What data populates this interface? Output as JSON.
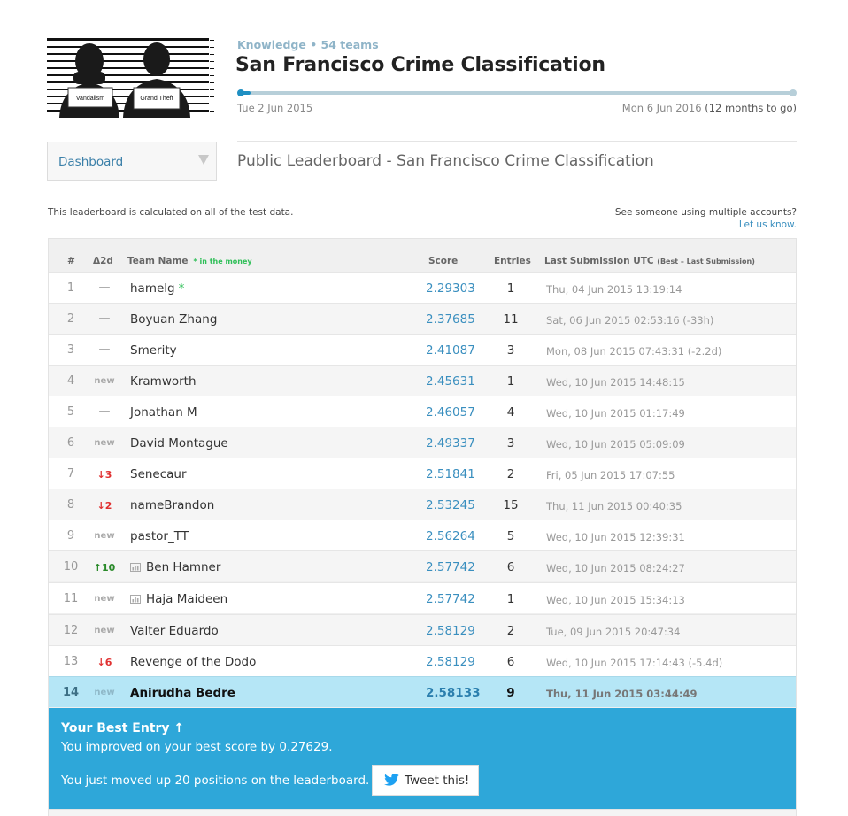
{
  "logo": {
    "label_left": "Vandalism",
    "label_right": "Grand Theft"
  },
  "competition": {
    "meta": "Knowledge • 54 teams",
    "title": "San Francisco Crime Classification",
    "start_date": "Tue 2 Jun 2015",
    "end_date": "Mon 6 Jun 2016",
    "remaining": "(12 months to go)",
    "elapsed_fraction": 0.02,
    "accent_color": "#1f8fc2"
  },
  "nav": {
    "dropdown_label": "Dashboard",
    "page_title": "Public Leaderboard - San Francisco Crime Classification"
  },
  "notes": {
    "left": "This leaderboard is calculated on all of the test data.",
    "right": "See someone using multiple accounts?",
    "right_link": "Let us know."
  },
  "columns": {
    "rank": "#",
    "delta": "Δ2d",
    "team": "Team Name",
    "in_money": "* in the money",
    "score": "Score",
    "help_icon": "?",
    "entries": "Entries",
    "last_submission": "Last Submission UTC",
    "last_submission_sub": "(Best – Last Submission)"
  },
  "rows": [
    {
      "rank": "1",
      "delta": "—",
      "delta_type": "same",
      "team": "hamelg",
      "star": "*",
      "score": "2.29303",
      "entries": "1",
      "date": "Thu, 04 Jun 2015 13:19:14"
    },
    {
      "rank": "2",
      "delta": "—",
      "delta_type": "same",
      "team": "Boyuan Zhang",
      "score": "2.37685",
      "entries": "11",
      "date": "Sat, 06 Jun 2015 02:53:16 (-33h)"
    },
    {
      "rank": "3",
      "delta": "—",
      "delta_type": "same",
      "team": "Smerity",
      "score": "2.41087",
      "entries": "3",
      "date": "Mon, 08 Jun 2015 07:43:31 (-2.2d)"
    },
    {
      "rank": "4",
      "delta": "new",
      "delta_type": "new",
      "team": "Kramworth",
      "score": "2.45631",
      "entries": "1",
      "date": "Wed, 10 Jun 2015 14:48:15"
    },
    {
      "rank": "5",
      "delta": "—",
      "delta_type": "same",
      "team": "Jonathan M",
      "score": "2.46057",
      "entries": "4",
      "date": "Wed, 10 Jun 2015 01:17:49"
    },
    {
      "rank": "6",
      "delta": "new",
      "delta_type": "new",
      "team": "David Montague",
      "score": "2.49337",
      "entries": "3",
      "date": "Wed, 10 Jun 2015 05:09:09"
    },
    {
      "rank": "7",
      "delta": "↓3",
      "delta_type": "down",
      "team": "Senecaur",
      "score": "2.51841",
      "entries": "2",
      "date": "Fri, 05 Jun 2015 17:07:55"
    },
    {
      "rank": "8",
      "delta": "↓2",
      "delta_type": "down",
      "team": "nameBrandon",
      "score": "2.53245",
      "entries": "15",
      "date": "Thu, 11 Jun 2015 00:40:35"
    },
    {
      "rank": "9",
      "delta": "new",
      "delta_type": "new",
      "team": "pastor_TT",
      "score": "2.56264",
      "entries": "5",
      "date": "Wed, 10 Jun 2015 12:39:31"
    },
    {
      "rank": "10",
      "delta": "↑10",
      "delta_type": "up",
      "team": "Ben Hamner",
      "profile": true,
      "score": "2.57742",
      "entries": "6",
      "date": "Wed, 10 Jun 2015 08:24:27"
    },
    {
      "rank": "11",
      "delta": "new",
      "delta_type": "new",
      "team": "Haja Maideen",
      "profile": true,
      "score": "2.57742",
      "entries": "1",
      "date": "Wed, 10 Jun 2015 15:34:13"
    },
    {
      "rank": "12",
      "delta": "new",
      "delta_type": "new",
      "team": "Valter Eduardo",
      "score": "2.58129",
      "entries": "2",
      "date": "Tue, 09 Jun 2015 20:47:34"
    },
    {
      "rank": "13",
      "delta": "↓6",
      "delta_type": "down",
      "team": "Revenge of the Dodo",
      "score": "2.58129",
      "entries": "6",
      "date": "Wed, 10 Jun 2015 17:14:43 (-5.4d)"
    },
    {
      "rank": "14",
      "delta": "new",
      "delta_type": "new",
      "team": "Anirudha Bedre",
      "score": "2.58133",
      "entries": "9",
      "date": "Thu, 11 Jun 2015 03:44:49",
      "is_me": true
    }
  ],
  "best_entry": {
    "title": "Your Best Entry ↑",
    "improved": "You improved on your best score by 0.27629.",
    "moved": "You just moved up 20 positions on the leaderboard.",
    "tweet_label": "Tweet this!",
    "box_color": "#2ea7d9"
  }
}
